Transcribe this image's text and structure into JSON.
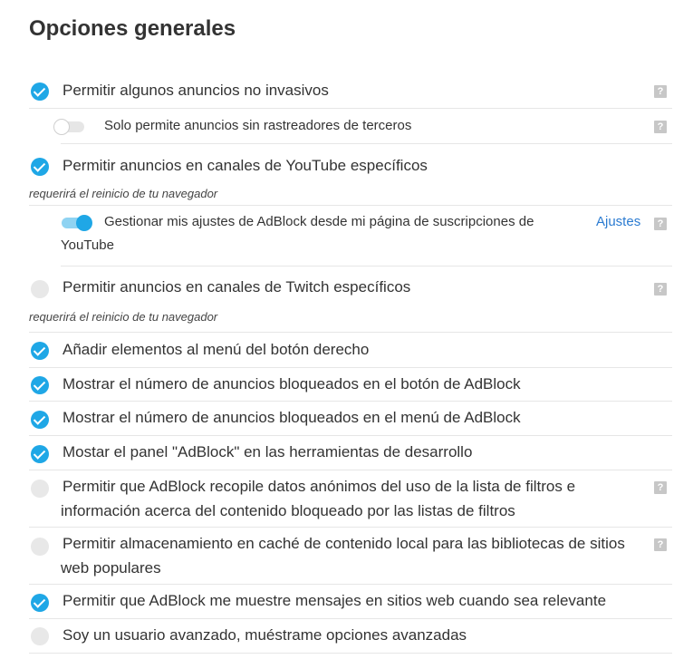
{
  "page": {
    "title": "Opciones generales"
  },
  "options": {
    "acceptable_ads": {
      "label": "Permitir algunos anuncios no invasivos",
      "checked": true,
      "help": "?"
    },
    "acceptable_ads_privacy": {
      "label": "Solo permite anuncios sin rastreadores de terceros",
      "enabled": false,
      "help": "?"
    },
    "youtube_channels": {
      "label": "Permitir anuncios en canales de YouTube específicos",
      "checked": true,
      "note": "requerirá el reinicio de tu navegador"
    },
    "youtube_manage": {
      "label_line1": "Gestionar mis ajustes de AdBlock desde mi página de suscripciones de",
      "label_line2": "YouTube",
      "enabled": true,
      "link": "Ajustes",
      "help": "?"
    },
    "twitch_channels": {
      "label": "Permitir anuncios en canales de Twitch específicos",
      "checked": false,
      "help": "?",
      "note": "requerirá el reinicio de tu navegador"
    },
    "context_menu": {
      "label": "Añadir elementos al menú del botón derecho",
      "checked": true
    },
    "badge_count": {
      "label": "Mostrar el número de anuncios bloqueados en el botón de AdBlock",
      "checked": true
    },
    "menu_count": {
      "label": "Mostrar el número de anuncios bloqueados en el menú de AdBlock",
      "checked": true
    },
    "devtools_panel": {
      "label": "Mostar el panel \"AdBlock\" en las herramientas de desarrollo",
      "checked": true
    },
    "data_collection": {
      "label_line1": "Permitir que AdBlock recopile datos anónimos del uso de la lista de filtros e",
      "label_line2": "información acerca del contenido bloqueado por las listas de filtros",
      "checked": false,
      "help": "?"
    },
    "local_cdn": {
      "label_line1": "Permitir almacenamiento en caché de contenido local para las bibliotecas de sitios",
      "label_line2": "web populares",
      "checked": false,
      "help": "?"
    },
    "messages": {
      "label": "Permitir que AdBlock me muestre mensajes en sitios web cuando sea relevante",
      "checked": true
    },
    "advanced_user": {
      "label": "Soy un usuario avanzado, muéstrame opciones avanzadas",
      "checked": false
    }
  },
  "colors": {
    "accent": "#1fa7e6",
    "link": "#2b7bd1",
    "unchecked": "#e8e8e8",
    "help_icon": "#c7c7c7"
  }
}
